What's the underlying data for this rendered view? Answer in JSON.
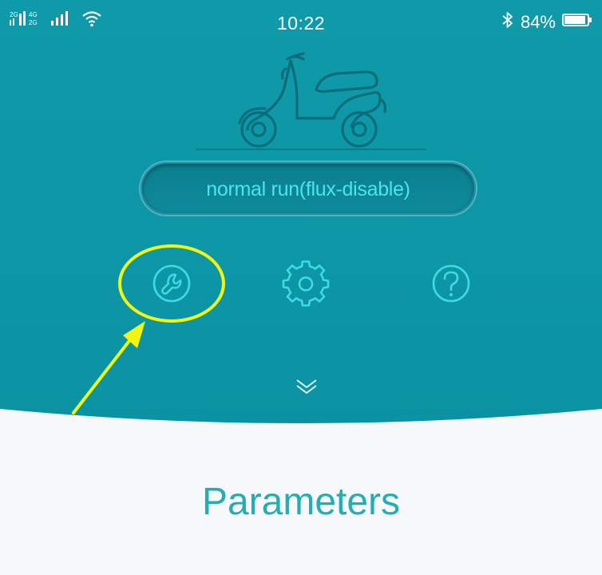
{
  "status_bar": {
    "signal_left": "2G",
    "network": "4G 2G",
    "time": "10:22",
    "battery_percent": "84%",
    "icons": [
      "signal-icon",
      "wifi-icon",
      "bluetooth-icon",
      "battery-icon"
    ]
  },
  "header": {
    "vehicle_icon": "scooter-icon",
    "mode_label": "normal run(flux-disable)"
  },
  "toolbar": {
    "buttons": [
      {
        "icon": "wrench-icon",
        "highlighted": true
      },
      {
        "icon": "gear-icon",
        "highlighted": false
      },
      {
        "icon": "help-icon",
        "highlighted": false
      }
    ],
    "expand_icon": "chevron-down-icon"
  },
  "annotation": {
    "shape": "ellipse",
    "pointer": "arrow",
    "color": "#f2f511"
  },
  "section": {
    "title": "Parameters"
  },
  "colors": {
    "header_bg": "#0f98a8",
    "accent_text": "#48e6ea",
    "title_text": "#25adb4",
    "page_bg": "#f7f8f9"
  }
}
